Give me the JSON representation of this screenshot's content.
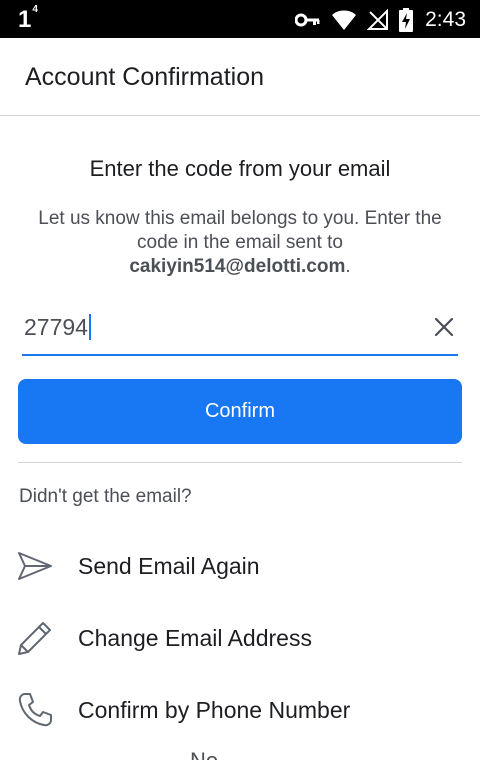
{
  "status_bar": {
    "left_indicator": "1",
    "left_superscript": "4",
    "time": "2:43",
    "icons": [
      "key-icon",
      "wifi-icon",
      "no-signal-icon",
      "battery-charging-icon"
    ]
  },
  "header": {
    "title": "Account Confirmation"
  },
  "main": {
    "heading": "Enter the code from your email",
    "instructions_prefix": "Let us know this email belongs to you. Enter the code in the email sent to ",
    "email": "cakiyin514@delotti.com",
    "instructions_suffix": ".",
    "code_value": "27794",
    "confirm_label": "Confirm",
    "no_email_label": "Didn't get the email?",
    "options": [
      {
        "label": "Send Email Again",
        "icon": "send-icon"
      },
      {
        "label": "Change Email Address",
        "icon": "pencil-icon"
      },
      {
        "label": "Confirm by Phone Number",
        "icon": "phone-icon"
      }
    ],
    "partial_text": "No..."
  },
  "colors": {
    "accent": "#1877f2",
    "text_primary": "#1c1e21",
    "text_secondary": "#4b4f56",
    "divider": "#d4d6da"
  }
}
